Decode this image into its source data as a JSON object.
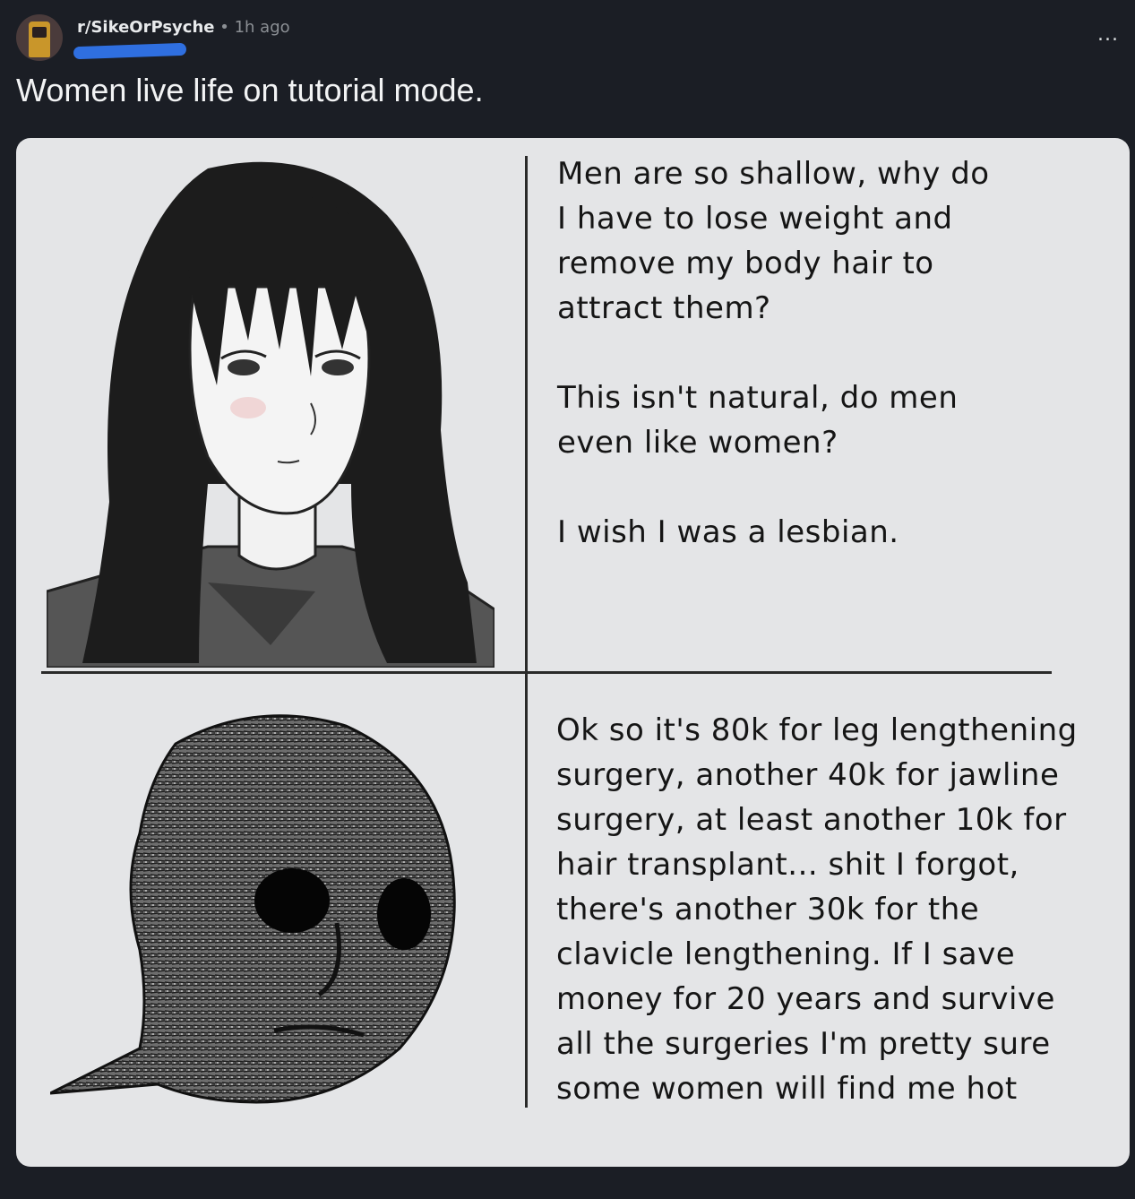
{
  "post": {
    "subreddit": "r/SikeOrPsyche",
    "separator": "•",
    "time": "1h ago",
    "more": "...",
    "title": "Women live life on tutorial mode."
  },
  "meme": {
    "top_panel": {
      "image": "sad-girl-drawing",
      "paragraphs": [
        "Men are so shallow, why do I have to lose weight and remove my body hair to attract them?",
        "This isn't natural, do men even like women?",
        "I wish I was a lesbian."
      ]
    },
    "bottom_panel": {
      "image": "withered-wojak-drawing",
      "paragraphs": [
        "Ok so it's 80k for leg lengthening surgery, another 40k for jawline surgery, at least another 10k for hair transplant... shit I forgot, there's another 30k for the clavicle lengthening. If I save money for 20 years and survive all the surgeries I'm pretty sure some women will find me hot"
      ]
    }
  },
  "colors": {
    "background": "#1b1e25",
    "meme_background": "#e4e5e7",
    "redaction": "#2f6fe0"
  }
}
